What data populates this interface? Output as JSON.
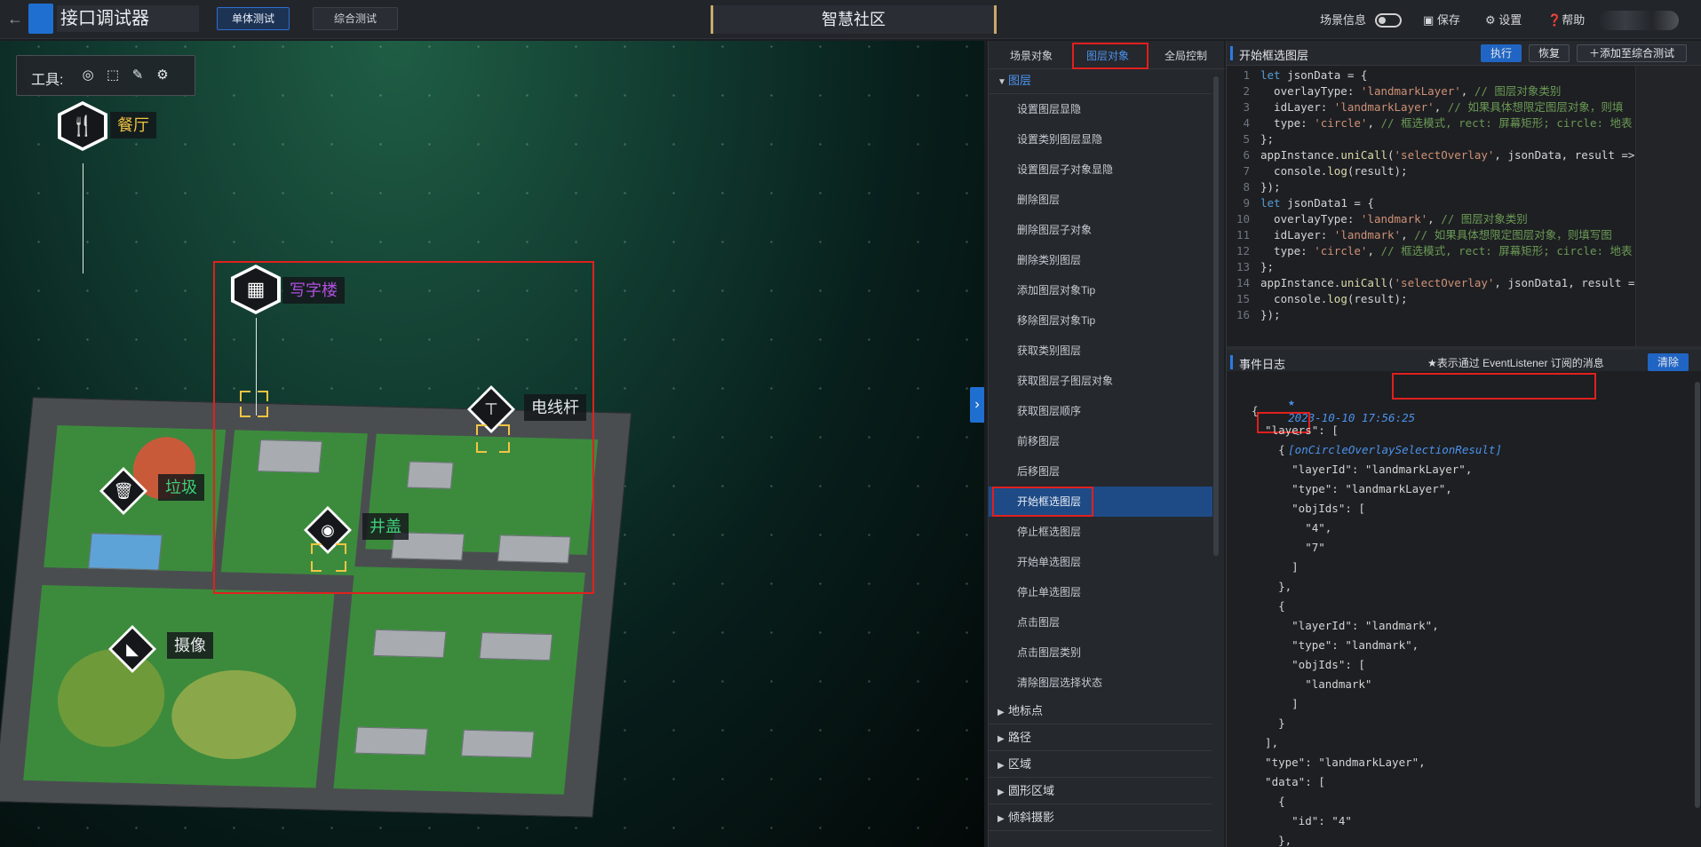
{
  "app": {
    "title": "接口调试器",
    "back_icon": "arrow-left-icon"
  },
  "modes": {
    "single": "单体测试",
    "combined": "综合测试"
  },
  "scene": {
    "name": "智慧社区"
  },
  "header": {
    "scene_info": "场景信息",
    "save": "保存",
    "settings": "设置",
    "help": "帮助"
  },
  "toolbar": {
    "label": "工具:"
  },
  "markers": {
    "restaurant": "餐厅",
    "office": "写字楼",
    "pole": "电线杆",
    "trash": "垃圾",
    "manhole": "井盖",
    "camera": "摄像"
  },
  "tabs": {
    "scene_objects": "场景对象",
    "layer_objects": "图层对象",
    "global_control": "全局控制"
  },
  "menu": {
    "layer_group": "图层",
    "items": [
      "设置图层显隐",
      "设置类别图层显隐",
      "设置图层子对象显隐",
      "删除图层",
      "删除图层子对象",
      "删除类别图层",
      "添加图层对象Tip",
      "移除图层对象Tip",
      "获取类别图层",
      "获取图层子图层对象",
      "获取图层顺序",
      "前移图层",
      "后移图层",
      "开始框选图层",
      "停止框选图层",
      "开始单选图层",
      "停止单选图层",
      "点击图层",
      "点击图层类别",
      "清除图层选择状态"
    ],
    "groups": [
      "地标点",
      "路径",
      "区域",
      "圆形区域",
      "倾斜摄影"
    ]
  },
  "code_panel": {
    "title": "开始框选图层",
    "run": "执行",
    "restore": "恢复",
    "add": "添加至综合测试",
    "lines": [
      [
        "let jsonData = {",
        "kw"
      ],
      [
        "  overlayType: 'landmarkLayer', // 图层对象类别",
        "s"
      ],
      [
        "  idLayer: 'landmarkLayer', // 如果具体想限定图层对象，则填",
        "s"
      ],
      [
        "  type: 'circle', // 框选模式, rect: 屏幕矩形; circle: 地表",
        "s"
      ],
      [
        "};",
        "p"
      ],
      [
        "appInstance.uniCall('selectOverlay', jsonData, result =>",
        "f"
      ],
      [
        "  console.log(result);",
        "p"
      ],
      [
        "});",
        "p"
      ],
      [
        "let jsonData1 = {",
        "kw"
      ],
      [
        "  overlayType: 'landmark', // 图层对象类别",
        "s"
      ],
      [
        "  idLayer: 'landmark', // 如果具体想限定图层对象，则填写图",
        "s"
      ],
      [
        "  type: 'circle', // 框选模式, rect: 屏幕矩形; circle: 地表",
        "s"
      ],
      [
        "};",
        "p"
      ],
      [
        "appInstance.uniCall('selectOverlay', jsonData1, result =",
        "f"
      ],
      [
        "  console.log(result);",
        "p"
      ],
      [
        "});",
        "p"
      ]
    ]
  },
  "log_panel": {
    "title": "事件日志",
    "note": "★表示通过 EventListener 订阅的消息",
    "clear": "清除",
    "timestamp": "2023-10-10 17:56:25",
    "event": "[onCircleOverlaySelectionResult]",
    "lines": [
      "{",
      "  \"layers\": [",
      "    {",
      "      \"layerId\": \"landmarkLayer\",",
      "      \"type\": \"landmarkLayer\",",
      "      \"objIds\": [",
      "        \"4\",",
      "        \"7\"",
      "      ]",
      "    },",
      "    {",
      "      \"layerId\": \"landmark\",",
      "      \"type\": \"landmark\",",
      "      \"objIds\": [",
      "        \"landmark\"",
      "      ]",
      "    }",
      "  ],",
      "  \"type\": \"landmarkLayer\",",
      "  \"data\": [",
      "    {",
      "      \"id\": \"4\"",
      "    },"
    ]
  },
  "colors": {
    "accent": "#2d7be5",
    "highlight": "#e0201e",
    "selected": "#1e4a86"
  }
}
